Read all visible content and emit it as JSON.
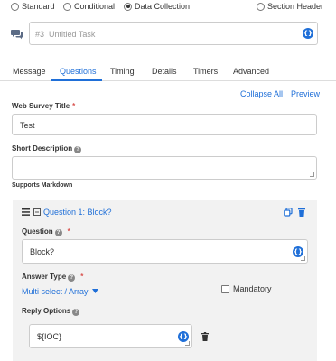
{
  "task_type": {
    "options": [
      "Standard",
      "Conditional",
      "Data Collection",
      "Section Header"
    ],
    "selected": "Data Collection"
  },
  "task": {
    "number": "#3",
    "placeholder": "Untitled Task"
  },
  "tabs": [
    "Message",
    "Questions",
    "Timing",
    "Details",
    "Timers",
    "Advanced"
  ],
  "active_tab": "Questions",
  "actions": {
    "collapse_all": "Collapse All",
    "preview": "Preview"
  },
  "survey": {
    "title_label": "Web Survey Title",
    "title_value": "Test",
    "desc_label": "Short Description",
    "desc_value": "",
    "markdown_hint": "Supports Markdown"
  },
  "question": {
    "header": "Question 1: Block?",
    "question_label": "Question",
    "question_value": "Block?",
    "answer_type_label": "Answer Type",
    "answer_type_value": "Multi select / Array",
    "mandatory_label": "Mandatory",
    "mandatory_checked": false,
    "reply_options_label": "Reply Options",
    "reply_option_value": "${IOC}"
  },
  "colors": {
    "accent": "#1f6fd8",
    "required": "#d9534f",
    "card_bg": "#f2f2f2"
  }
}
